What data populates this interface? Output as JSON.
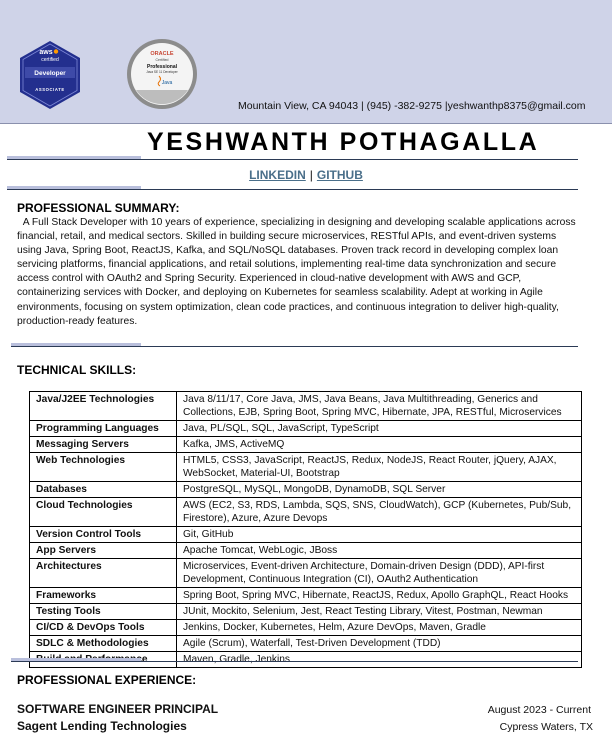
{
  "header": {
    "aws_badge": {
      "line1": "aws",
      "line2": "certified",
      "line3": "Developer",
      "line4": "ASSOCIATE",
      "colors": {
        "badge": "#232f8e",
        "accent": "#ff9900"
      }
    },
    "oracle_badge": {
      "brand": "ORACLE",
      "line1": "Certified",
      "line2": "Professional",
      "line3": "Java SE 11 Developer",
      "logo": "Java",
      "colors": {
        "ring": "#888888",
        "brand": "#c74634"
      }
    },
    "contact": {
      "location": "Mountain View, CA 94043",
      "phone": "(945) -382-9275",
      "email": "yeshwanthp8375@gmail.com"
    }
  },
  "name": "YESHWANTH POTHAGALLA",
  "links": {
    "linkedin": "LINKEDIN",
    "separator": "|",
    "github": "GITHUB"
  },
  "summary": {
    "title": "PROFESSIONAL SUMMARY:",
    "text": "A Full Stack Developer with 10 years of experience, specializing in designing and developing scalable applications across financial, retail, and medical sectors. Skilled in building secure microservices, RESTful APIs, and event-driven systems using Java, Spring Boot, ReactJS, Kafka, and SQL/NoSQL databases. Proven track record in developing complex loan servicing platforms, financial applications, and retail solutions, implementing real-time data synchronization and secure access control with OAuth2 and Spring Security. Experienced in cloud-native development with AWS and GCP, containerizing services with Docker, and deploying on Kubernetes for seamless scalability. Adept at working in Agile environments, focusing on system optimization, clean code practices, and continuous integration to deliver high-quality, production-ready features."
  },
  "skills": {
    "title": "TECHNICAL SKILLS:",
    "rows": [
      {
        "category": "Java/J2EE Technologies",
        "value": "Java 8/11/17, Core Java, JMS, Java Beans, Java Multithreading, Generics and Collections, EJB, Spring Boot, Spring MVC, Hibernate, JPA, RESTful, Microservices"
      },
      {
        "category": "Programming Languages",
        "value": "Java, PL/SQL, SQL, JavaScript, TypeScript"
      },
      {
        "category": "Messaging Servers",
        "value": "Kafka, JMS, ActiveMQ"
      },
      {
        "category": "Web Technologies",
        "value": "HTML5, CSS3, JavaScript, ReactJS, Redux, NodeJS, React Router, jQuery, AJAX, WebSocket, Material-UI, Bootstrap"
      },
      {
        "category": "Databases",
        "value": "PostgreSQL, MySQL, MongoDB, DynamoDB, SQL Server"
      },
      {
        "category": "Cloud Technologies",
        "value": "AWS (EC2, S3, RDS, Lambda, SQS, SNS, CloudWatch), GCP (Kubernetes, Pub/Sub, Firestore), Azure, Azure Devops"
      },
      {
        "category": "Version Control Tools",
        "value": "Git, GitHub"
      },
      {
        "category": "App Servers",
        "value": "Apache Tomcat, WebLogic, JBoss"
      },
      {
        "category": "Architectures",
        "value": "Microservices, Event-driven Architecture, Domain-driven Design (DDD), API-first Development, Continuous Integration (CI), OAuth2 Authentication"
      },
      {
        "category": "Frameworks",
        "value": "Spring Boot, Spring MVC, Hibernate, ReactJS, Redux, Apollo GraphQL, React Hooks"
      },
      {
        "category": "Testing Tools",
        "value": "JUnit, Mockito, Selenium, Jest, React Testing Library, Vitest, Postman, Newman"
      },
      {
        "category": "CI/CD & DevOps Tools",
        "value": "Jenkins, Docker, Kubernetes, Helm, Azure DevOps, Maven, Gradle"
      },
      {
        "category": "SDLC & Methodologies",
        "value": "Agile (Scrum), Waterfall, Test-Driven Development (TDD)"
      },
      {
        "category": "Build and Performance",
        "value": "Maven, Gradle, Jenkins"
      }
    ]
  },
  "experience": {
    "title": "PROFESSIONAL EXPERIENCE:",
    "job": {
      "title": "SOFTWARE ENGINEER PRINCIPAL",
      "company": "Sagent Lending Technologies",
      "date": "August 2023 - Current",
      "location": "Cypress Waters, TX"
    }
  }
}
